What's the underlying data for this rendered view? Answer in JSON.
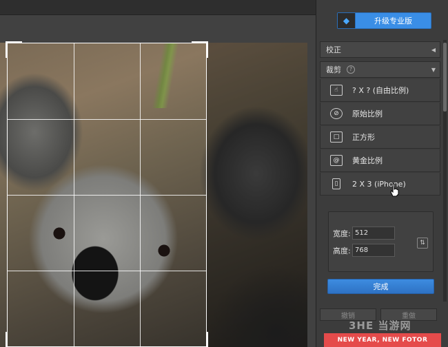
{
  "panel": {
    "upgrade_label": "升级专业版",
    "sections": {
      "correct": "校正",
      "crop": "裁剪"
    },
    "options": [
      {
        "label": "? X ? (自由比例)",
        "icon": "hand-icon"
      },
      {
        "label": "原始比例",
        "icon": "no-ratio-icon"
      },
      {
        "label": "正方形",
        "icon": "square-icon"
      },
      {
        "label": "黄金比例",
        "icon": "spiral-icon"
      },
      {
        "label": "2 X 3 (iPhone)",
        "icon": "phone-icon"
      }
    ],
    "width_label": "宽度:",
    "width_value": "512",
    "height_label": "高度:",
    "height_value": "768",
    "done_label": "完成",
    "undo_label": "撤销",
    "redo_label": "重做"
  },
  "watermark": "3HE 当游网",
  "promo": "NEW YEAR, NEW FOTOR",
  "colors": {
    "accent": "#3a8ee6",
    "panel_bg": "#3c3c3c",
    "promo_bg": "#e54b4b"
  }
}
